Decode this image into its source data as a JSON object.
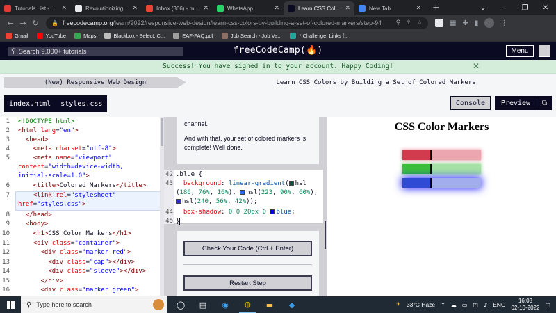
{
  "browser": {
    "tabs": [
      {
        "label": "Tutorials List - Java",
        "favicon_color": "#e53935",
        "active": false
      },
      {
        "label": "Revolutionizing the",
        "favicon_color": "#e8eaed",
        "active": false
      },
      {
        "label": "Inbox (366) - mano",
        "favicon_color": "#ea4335",
        "active": false
      },
      {
        "label": "WhatsApp",
        "favicon_color": "#25d366",
        "active": false
      },
      {
        "label": "Learn CSS Colors b",
        "favicon_color": "#0a0a23",
        "active": true
      },
      {
        "label": "New Tab",
        "favicon_color": "#4285f4",
        "active": false
      }
    ],
    "url_host": "freecodecamp.org",
    "url_path": "/learn/2022/responsive-web-design/learn-css-colors-by-building-a-set-of-colored-markers/step-94",
    "bookmarks": [
      {
        "label": "Gmail",
        "color": "#ea4335"
      },
      {
        "label": "YouTube",
        "color": "#ff0000"
      },
      {
        "label": "Maps",
        "color": "#34a853"
      },
      {
        "label": "Blackbox - Select. C...",
        "color": "#bdbdbd"
      },
      {
        "label": "EAF-FAQ.pdf",
        "color": "#9e9e9e"
      },
      {
        "label": "Job Search - Job Va...",
        "color": "#8d6e63"
      },
      {
        "label": "* Challenge: Links f...",
        "color": "#26a69a"
      }
    ]
  },
  "fcc": {
    "search_placeholder": "Search 9,000+ tutorials",
    "logo": "freeCodeCamp(🔥)",
    "menu": "Menu",
    "alert": "Success! You have signed in to your account. Happy Coding!",
    "breadcrumb_superblock": "(New) Responsive Web Design",
    "breadcrumb_block": "Learn CSS Colors by Building a Set of Colored Markers",
    "file_tabs": [
      "index.html",
      "styles.css"
    ],
    "console_label": "Console",
    "preview_label": "Preview"
  },
  "editor": {
    "line_numbers": [
      "1",
      "2",
      "3",
      "4",
      "5",
      "",
      "",
      "6",
      "7",
      "",
      "8",
      "9",
      "10",
      "11",
      "12",
      "13",
      "14",
      "15",
      "16"
    ]
  },
  "instructions": {
    "para1": "channel.",
    "para2": "And with that, your set of colored markers is complete! Well done.",
    "code_line_numbers": [
      "42",
      "43",
      "",
      "",
      "44",
      "45"
    ],
    "check_button": "Check Your Code (Ctrl + Enter)",
    "restart_button": "Restart Step"
  },
  "preview": {
    "title": "CSS Color Markers",
    "markers": [
      {
        "name": "red",
        "color": "#d23a4e",
        "glow": "rgba(210,58,78,0.5)"
      },
      {
        "name": "green",
        "color": "#3bbf3b",
        "glow": "rgba(59,191,59,0.5)"
      },
      {
        "name": "blue",
        "color": "#2f4bd6",
        "glow": "rgba(0,0,255,0.9)"
      }
    ]
  },
  "taskbar": {
    "search_placeholder": "Type here to search",
    "weather": "33°C Haze",
    "lang": "ENG",
    "time": "16:03",
    "date": "02-10-2022"
  }
}
